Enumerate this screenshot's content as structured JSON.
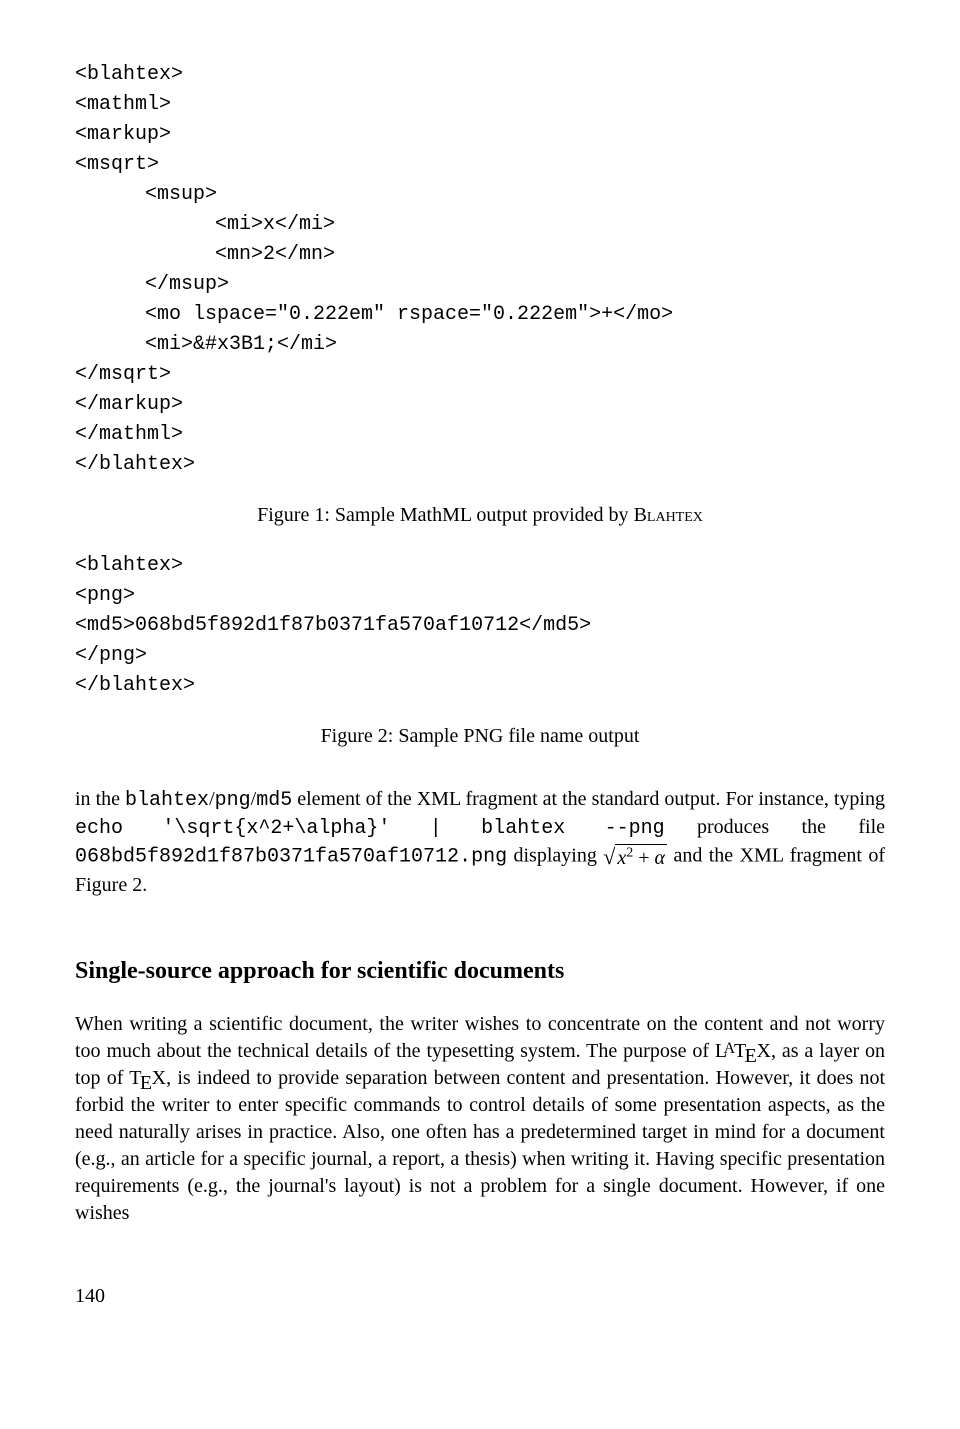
{
  "code_block1": {
    "l1": "<blahtex>",
    "l2": "<mathml>",
    "l3": "<markup>",
    "l4": "<msqrt>",
    "l5": "<msup>",
    "l6": "<mi>x</mi>",
    "l7": "<mn>2</mn>",
    "l8": "</msup>",
    "l9": "<mo lspace=\"0.222em\" rspace=\"0.222em\">+</mo>",
    "l10": "<mi>&#x3B1;</mi>",
    "l11": "</msqrt>",
    "l12": "</markup>",
    "l13": "</mathml>",
    "l14": "</blahtex>"
  },
  "figure1_caption_pre": "Figure 1: Sample MathML output provided by ",
  "figure1_caption_sc": "Blahtex",
  "code_block2": {
    "l1": "<blahtex>",
    "l2": "<png>",
    "l3": "<md5>068bd5f892d1f87b0371fa570af10712</md5>",
    "l4": "</png>",
    "l5": "</blahtex>"
  },
  "figure2_caption": "Figure 2: Sample PNG file name output",
  "para1": {
    "pre": "in the ",
    "tt1": "blahtex",
    "slash1": "/",
    "tt2": "png",
    "slash2": "/",
    "tt3": "md5",
    "mid1": " element of the XML fragment at the standard output. For instance, typing ",
    "tt4": "echo '\\sqrt{x^2+\\alpha}' | blahtex --png",
    "mid2": " produces the file ",
    "tt5": "068bd5f892d1f87b0371fa570af10712.png",
    "mid3": " displaying ",
    "sqrt_x": "x",
    "sqrt_exp": "2",
    "sqrt_plus": " + ",
    "sqrt_alpha": "α",
    "end": " and the XML fragment of Figure 2."
  },
  "section_heading": "Single-source approach for scientific documents",
  "para2": {
    "t1": "When writing a scientific document, the writer wishes to concentrate on the content and not worry too much about the technical details of the typesetting system. The purpose of ",
    "latex_L": "L",
    "latex_A": "A",
    "latex_T": "T",
    "latex_E": "E",
    "latex_X": "X",
    "t2": ", as a layer on top of ",
    "tex_T": "T",
    "tex_E": "E",
    "tex_X": "X",
    "t3": ", is indeed to provide separation between content and presentation. However, it does not forbid the writer to enter specific commands to control details of some presentation aspects, as the need naturally arises in practice. Also, one often has a predetermined target in mind for a document (e.g., an article for a specific journal, a report, a thesis) when writing it. Having specific presentation requirements (e.g., the journal's layout) is not a problem for a single document. However, if one wishes"
  },
  "page_number": "140"
}
